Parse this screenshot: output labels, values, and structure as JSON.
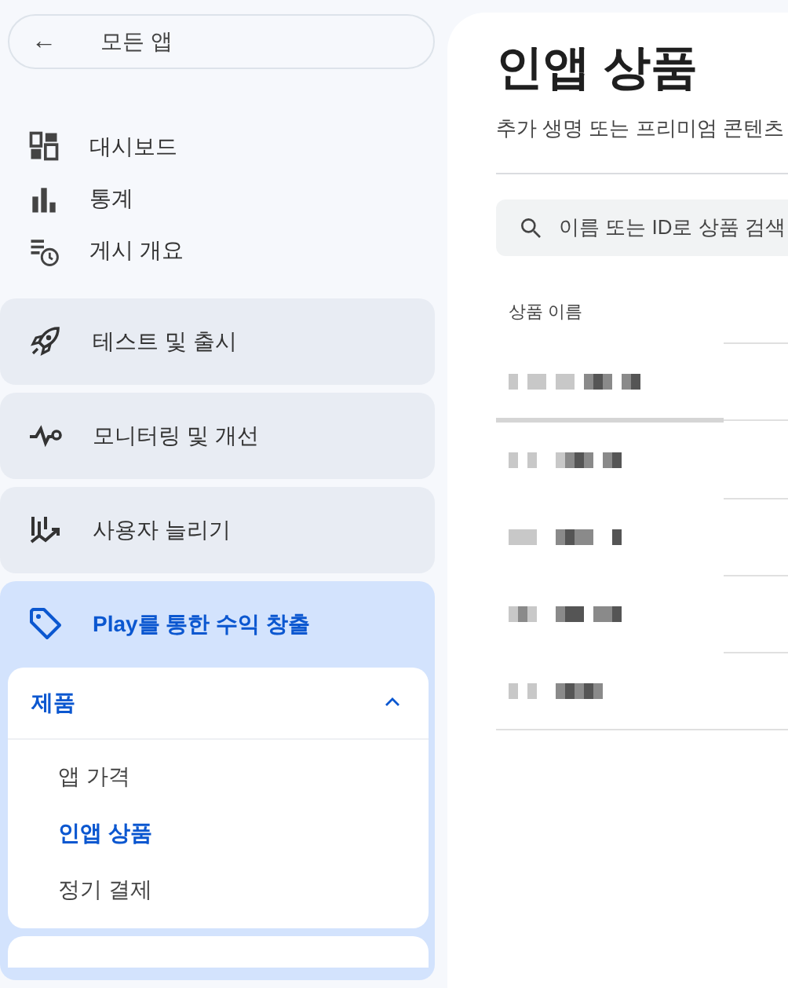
{
  "back_button": {
    "label": "모든 앱",
    "icon": "←"
  },
  "nav_items": [
    {
      "label": "대시보드",
      "kind": "dashboard"
    },
    {
      "label": "통계",
      "kind": "bars"
    },
    {
      "label": "게시 개요",
      "kind": "clock"
    }
  ],
  "sections": [
    {
      "label": "테스트 및 출시",
      "kind": "rocket",
      "selected": false
    },
    {
      "label": "모니터링 및 개선",
      "kind": "pulse",
      "selected": false
    },
    {
      "label": "사용자 늘리기",
      "kind": "growth",
      "selected": false
    },
    {
      "label": "Play를 통한 수익 창출",
      "kind": "tag",
      "selected": true,
      "groups": [
        {
          "label": "제품",
          "expanded": true,
          "items": [
            {
              "label": "앱 가격",
              "selected": false
            },
            {
              "label": "인앱 상품",
              "selected": true
            },
            {
              "label": "정기 결제",
              "selected": false
            }
          ]
        }
      ]
    }
  ],
  "page": {
    "title": "인앱 상품",
    "subtitle": "추가 생명 또는 프리미엄 콘텐츠",
    "search": {
      "placeholder": "이름 또는 ID로 상품 검색"
    },
    "table": {
      "columns": [
        "상품 이름"
      ],
      "rows": [
        {
          "kind": "redacted"
        },
        {
          "kind": "redacted"
        },
        {
          "kind": "redacted"
        },
        {
          "kind": "redacted"
        },
        {
          "kind": "redacted"
        }
      ]
    }
  }
}
